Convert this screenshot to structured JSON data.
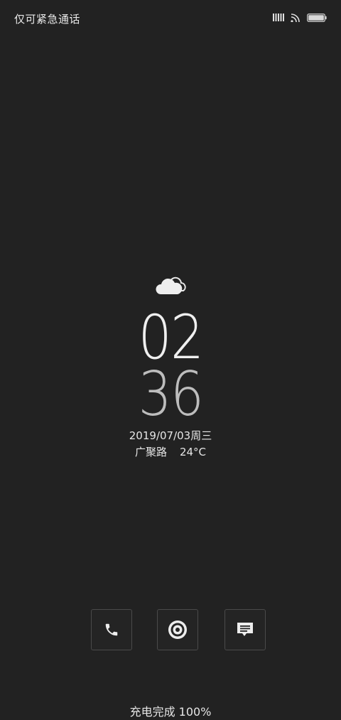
{
  "status_bar": {
    "carrier_text": "仅可紧急通话",
    "signal_icon": "signal-bars-icon",
    "wifi_icon": "wifi-icon",
    "battery_icon": "battery-icon",
    "battery_level": 1.0
  },
  "lock_screen": {
    "weather_icon": "cloud-icon",
    "hour": "02",
    "minute": "36",
    "date": "2019/07/03周三",
    "location": "广聚路",
    "temperature": "24°C"
  },
  "shortcuts": [
    {
      "name": "phone",
      "icon": "phone-icon"
    },
    {
      "name": "camera",
      "icon": "camera-icon"
    },
    {
      "name": "message",
      "icon": "message-icon"
    }
  ],
  "charge_status": "充电完成 100%",
  "colors": {
    "background": "#222222",
    "text": "#e6e6e6",
    "button_border": "#4a4a4a"
  }
}
